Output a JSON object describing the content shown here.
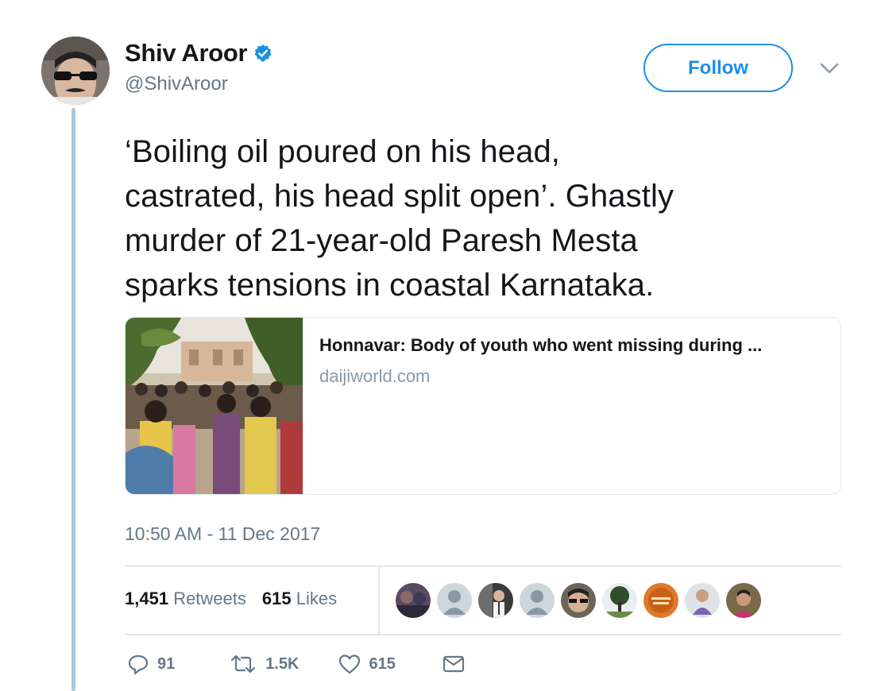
{
  "user": {
    "name": "Shiv Aroor",
    "handle": "@ShivAroor"
  },
  "follow_label": "Follow",
  "tweet": {
    "lines": [
      "‘Boiling oil poured on his head,",
      "castrated, his head split open’. Ghastly",
      "murder of 21-year-old Paresh Mesta",
      "sparks tensions in coastal Karnataka."
    ]
  },
  "card": {
    "title": "Honnavar: Body of youth who went missing during ...",
    "domain": "daijiworld.com"
  },
  "timestamp": "10:50 AM - 11 Dec 2017",
  "stats": {
    "retweets_count": "1,451",
    "retweets_label": "Retweets",
    "likes_count": "615",
    "likes_label": "Likes"
  },
  "actions": {
    "replies": "91",
    "retweets": "1.5K",
    "likes": "615"
  },
  "colors": {
    "accent": "#1d8ee6",
    "thread_line": "#a9c7de",
    "muted": "#657786"
  },
  "icons": [
    "verified-badge-icon",
    "chevron-down-icon",
    "reply-icon",
    "retweet-icon",
    "heart-icon",
    "envelope-icon"
  ]
}
